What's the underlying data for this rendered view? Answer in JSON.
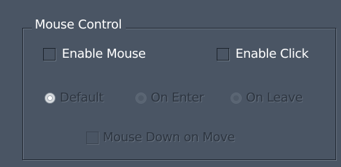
{
  "group": {
    "title": "Mouse Control"
  },
  "checkboxes": {
    "enable_mouse": {
      "label": "Enable Mouse",
      "checked": false,
      "enabled": true
    },
    "enable_click": {
      "label": "Enable Click",
      "checked": false,
      "enabled": true
    },
    "mouse_down_on_move": {
      "label": "Mouse Down on Move",
      "checked": false,
      "enabled": false
    }
  },
  "radios": [
    {
      "label": "Default",
      "selected": true,
      "enabled": false
    },
    {
      "label": "On Enter",
      "selected": false,
      "enabled": false
    },
    {
      "label": "On Leave",
      "selected": false,
      "enabled": false
    }
  ],
  "colors": {
    "background": "#4a5564",
    "text_enabled": "#ffffff",
    "text_disabled": "#2d3540"
  }
}
